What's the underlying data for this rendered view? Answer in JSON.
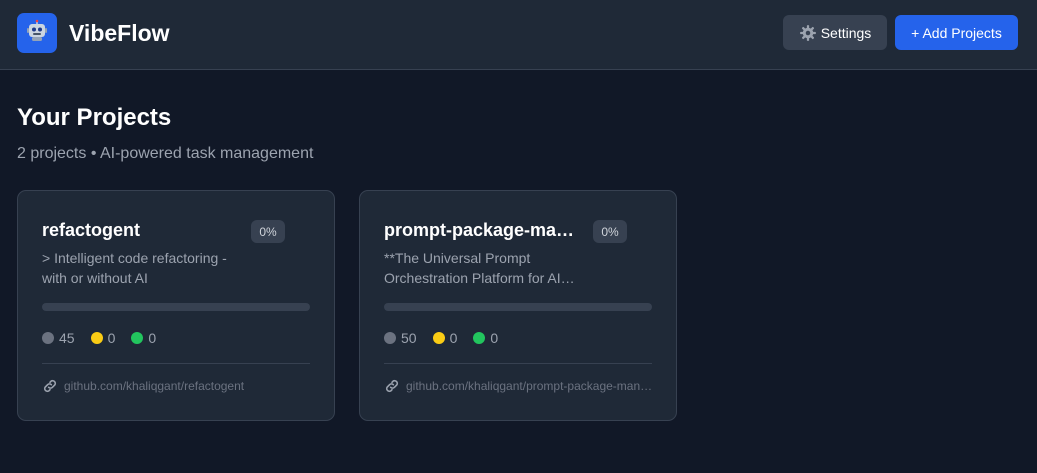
{
  "app": {
    "brand": "VibeFlow",
    "logo_icon": "robot-icon",
    "accent_color": "#2563eb"
  },
  "header": {
    "settings_label": "Settings",
    "add_label": "+ Add Projects"
  },
  "main": {
    "title": "Your Projects",
    "subtitle": "2 projects • AI-powered task management"
  },
  "projects": [
    {
      "name": "refactogent",
      "progress_label": "0%",
      "progress": 0,
      "description": "> Intelligent code refactoring - with or without AI",
      "stats": {
        "todo": "45",
        "in_progress": "0",
        "done": "0"
      },
      "repo": "github.com/khaliqgant/refactogent"
    },
    {
      "name": "prompt-package-manager",
      "progress_label": "0%",
      "progress": 0,
      "description": "**The Universal Prompt Orchestration Platform for AI Development",
      "stats": {
        "todo": "50",
        "in_progress": "0",
        "done": "0"
      },
      "repo": "github.com/khaliqgant/prompt-package-manager"
    }
  ],
  "status_colors": {
    "todo": "#6b7280",
    "in_progress": "#facc15",
    "done": "#22c55e"
  }
}
